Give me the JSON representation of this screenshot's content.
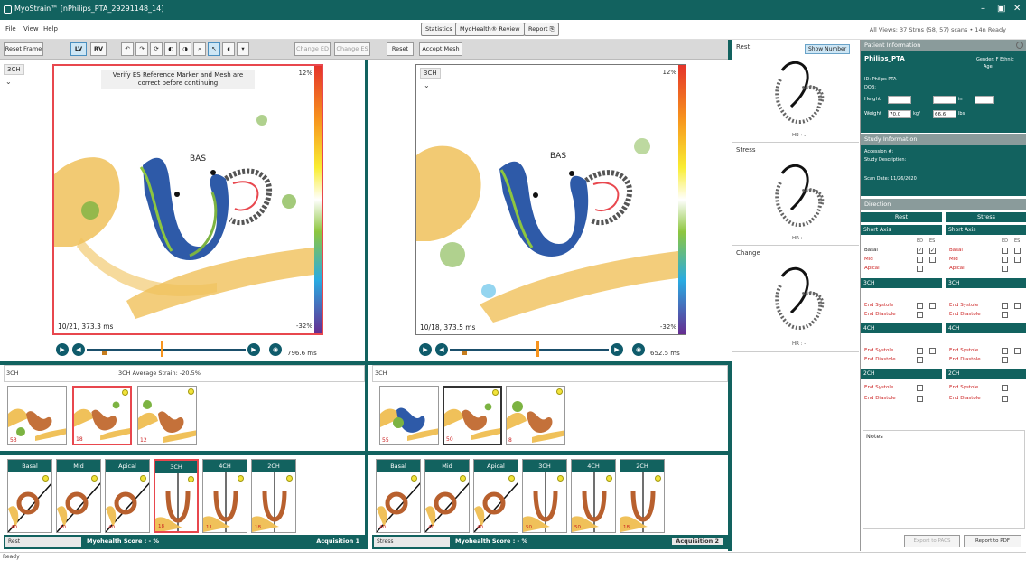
{
  "window": {
    "title": "MyoStrain™ [nPhilips_PTA_29291148_14]"
  },
  "menu": {
    "file": "File",
    "view": "View",
    "help": "Help"
  },
  "top_buttons": {
    "statistics": "Statistics",
    "myostrain_review": "MyoHealth® Review",
    "report": "Report ⎘"
  },
  "top_status": "All Views: 37 Strns (58, 57) scans • 14n  Ready",
  "toolbar": {
    "reset_frame": "Reset Frame",
    "lv": "LV",
    "rv": "RV",
    "change_ed": "Change ED",
    "change_es": "Change ES",
    "reset": "Reset",
    "accept_mesh": "Accept Mesh"
  },
  "left_view": {
    "view_name": "3CH",
    "notice": "Verify ES Reference Marker and Mesh are correct before continuing",
    "max_label": "12%",
    "min_label": "-32%",
    "frame_time": "10/21, 373.3 ms",
    "bas_label": "BAS",
    "duration": "796.6 ms",
    "strain_view": "3CH",
    "strain_avg": "3CH  Average Strain: -20.5%",
    "thumbs": [
      "53",
      "18",
      "12"
    ],
    "segments": [
      {
        "label": "Basal",
        "num": "40"
      },
      {
        "label": "Mid",
        "num": "40"
      },
      {
        "label": "Apical",
        "num": "40"
      },
      {
        "label": "3CH",
        "num": "18"
      },
      {
        "label": "4CH",
        "num": "11"
      },
      {
        "label": "2CH",
        "num": "18"
      }
    ],
    "state": "Rest",
    "score": "Myohealth Score : - %",
    "acquisition": "Acquisition 1"
  },
  "right_view": {
    "view_name": "3CH",
    "max_label": "12%",
    "min_label": "-32%",
    "frame_time": "10/18, 373.5 ms",
    "bas_label": "BAS",
    "duration": "652.5 ms",
    "strain_view": "3CH",
    "thumbs": [
      "55",
      "50",
      "8"
    ],
    "segments": [
      {
        "label": "Basal",
        "num": "40"
      },
      {
        "label": "Mid",
        "num": "40"
      },
      {
        "label": "Apical",
        "num": "40"
      },
      {
        "label": "3CH",
        "num": "50"
      },
      {
        "label": "4CH",
        "num": "50"
      },
      {
        "label": "2CH",
        "num": "18"
      }
    ],
    "state": "Stress",
    "score": "Myohealth Score : - %",
    "acquisition": "Acquisition 2"
  },
  "bullseye": {
    "rest_title": "Rest",
    "rest_button": "Show Number",
    "stress_title": "Stress",
    "change_title": "Change",
    "sub": "HR : -"
  },
  "patient": {
    "header": "Patient Information",
    "name": "Philips_PTA",
    "gender_age": "Gender: F  Ethnic",
    "age": "Age:",
    "id_line": "ID: Philips PTA",
    "dob": "DOB:",
    "height_label": "Height",
    "weight_label": "Weight",
    "weight_value": "70.0",
    "bmi_label": "kg/",
    "bmi_value": "66.6",
    "lbs_label": "lbs",
    "in_label": "in"
  },
  "study": {
    "header": "Study Information",
    "accession": "Accession #:",
    "description": "Study Description:",
    "scan_date": "Scan Date: 11/26/2020"
  },
  "direction": {
    "header": "Direction",
    "rest": "Rest",
    "stress": "Stress",
    "short_axis": "Short Axis",
    "col_ed": "ED",
    "col_es": "ES",
    "basal": "Basal",
    "mid": "Mid",
    "apical": "Apical",
    "ch3": "3CH",
    "ch4": "4CH",
    "ch2": "2CH",
    "end_systole": "End Systole",
    "end_diastole": "End Diastole"
  },
  "notes": {
    "label": "Notes"
  },
  "buttons": {
    "export_to_pacs": "Export to PACS",
    "report_to_pdf": "Report to PDF"
  },
  "status": "Ready",
  "colors": {
    "teal": "#12625f",
    "accent_red": "#e8474e",
    "playback": "#0f5b6b",
    "marker": "#f7941d"
  }
}
